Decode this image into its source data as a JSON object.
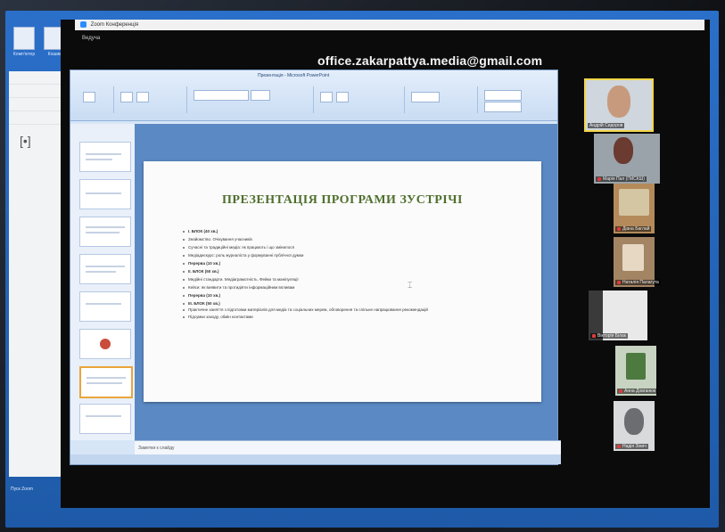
{
  "zoom": {
    "window_title": "Zoom Конференція",
    "share_label": "Ведуча",
    "email": "office.zakarpattya.media@gmail.com"
  },
  "powerpoint": {
    "window_title": "Презентація - Microsoft PowerPoint",
    "notes_placeholder": "Заметки к слайду",
    "slide": {
      "title": "ПРЕЗЕНТАЦІЯ ПРОГРАМИ ЗУСТРІЧІ",
      "bullets": [
        {
          "text": "І. БЛОК (40 хв.)",
          "bold": true
        },
        {
          "text": "Знайомство. Очікування учасників",
          "bold": false
        },
        {
          "text": "Сучасні та традиційні медіа: як працюють і що змінилося",
          "bold": false
        },
        {
          "text": "Медіадискурс: роль журналіста у формуванні публічної думки",
          "bold": false
        },
        {
          "text": "Перерва (10 хв.)",
          "bold": true
        },
        {
          "text": "ІІ. БЛОК (50 хв.)",
          "bold": true
        },
        {
          "text": "Медійні стандарти. Медіаграмотність. Фейки та маніпуляції",
          "bold": false
        },
        {
          "text": "Кейси: як виявити та протидіяти інформаційним впливам",
          "bold": false
        },
        {
          "text": "Перерва (10 хв.)",
          "bold": true
        },
        {
          "text": "ІІІ. БЛОК (50 хв.)",
          "bold": true
        },
        {
          "text": "Практичне заняття з підготовки матеріалів для медіа та соціальних мереж, обговорення та спільне напрацювання рекомендацій",
          "bold": false
        },
        {
          "text": "Підсумки заходу, обмін контактами",
          "bold": false
        }
      ]
    }
  },
  "participants": [
    {
      "name": "Андрій Сидоров",
      "muted": false,
      "active": true
    },
    {
      "name": "Марія Пал (ГМСКШ)",
      "muted": true,
      "active": false
    },
    {
      "name": "Діана Баглай",
      "muted": true,
      "active": false
    },
    {
      "name": "Наталія Палагута",
      "muted": true,
      "active": false
    },
    {
      "name": "Вікторія Білак",
      "muted": true,
      "active": false
    },
    {
      "name": "Анна Довганюк",
      "muted": true,
      "active": false
    },
    {
      "name": "Надія Зінич",
      "muted": true,
      "active": false
    }
  ],
  "desktop": {
    "icons": [
      "Комп'ютер",
      "Кошик"
    ],
    "taskbar_label": "Пуск  Zoom"
  }
}
